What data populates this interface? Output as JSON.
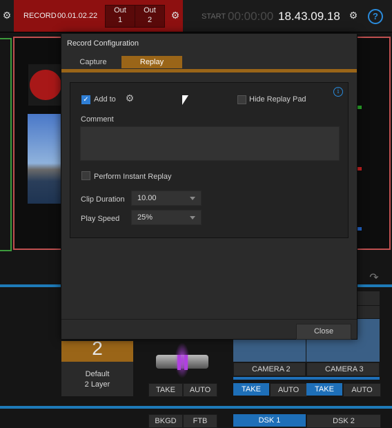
{
  "top": {
    "record_label": "RECORD",
    "record_time": "00.01.02.22",
    "out1": "Out\n1",
    "out2": "Out\n2",
    "start_label": "START",
    "start_time": "00:00:00",
    "clock": "18.43.09.18",
    "help": "?"
  },
  "dialog": {
    "title": "Record Configuration",
    "tabs": [
      "Capture",
      "Replay"
    ],
    "active_tab": "Replay",
    "add_to_label": "Add to",
    "add_to_checked": true,
    "hide_replay_pad_label": "Hide Replay Pad",
    "comment_label": "Comment",
    "comment_value": "",
    "instant_replay_label": "Perform Instant Replay",
    "clip_duration_label": "Clip Duration",
    "clip_duration_value": "10.00",
    "play_speed_label": "Play Speed",
    "play_speed_value": "25%",
    "close_label": "Close"
  },
  "bottom": {
    "layer_number": "2",
    "layer_label": "Default\n2 Layer",
    "take": "TAKE",
    "auto": "AUTO",
    "camera2": "CAMERA 2",
    "camera3": "CAMERA 3",
    "bkgd": "BKGD",
    "ftb": "FTB",
    "dsk1": "DSK 1",
    "dsk2": "DSK 2"
  },
  "colors": {
    "record_red": "#8e1010",
    "accent_orange": "#9a6518",
    "accent_blue": "#1e6fb8"
  }
}
